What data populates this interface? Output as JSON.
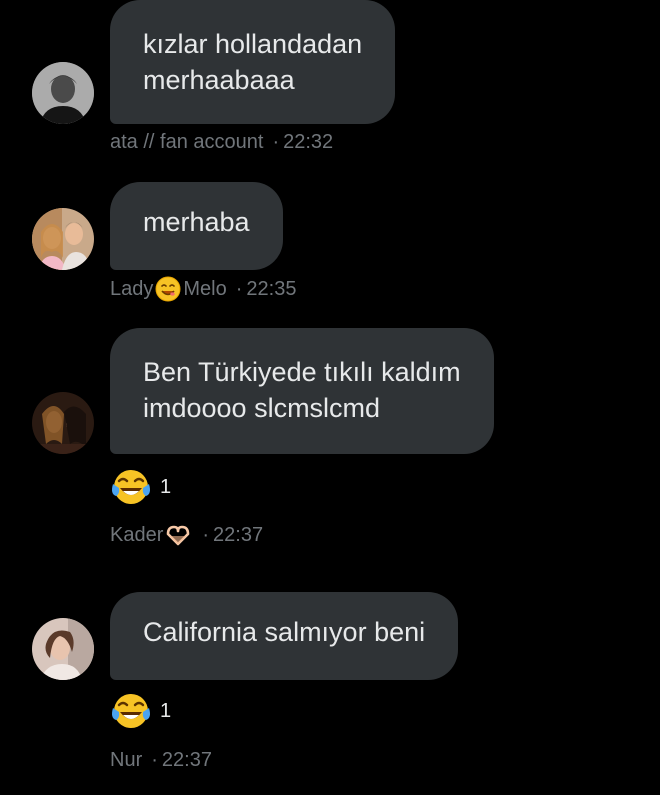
{
  "messages": [
    {
      "lines": [
        "kızlar hollandadan",
        "merhaabaaa"
      ],
      "sender": "ata // fan account",
      "time": "22:32",
      "reaction": null
    },
    {
      "lines": [
        "merhaba"
      ],
      "sender_prefix": "Lady",
      "sender_emoji": "smiling-face-emoji",
      "sender_suffix": "Melo",
      "time": "22:35",
      "reaction": null
    },
    {
      "lines": [
        "Ben Türkiyede tıkılı kaldım",
        "imdoooo slcmslcmd"
      ],
      "sender_prefix": "Kader",
      "sender_emoji": "heart-hands-emoji",
      "time": "22:37",
      "reaction": {
        "emoji": "tears-of-joy-emoji",
        "count": "1"
      }
    },
    {
      "lines": [
        "California salmıyor beni"
      ],
      "sender": "Nur",
      "time": "22:37",
      "reaction": {
        "emoji": "tears-of-joy-emoji",
        "count": "1"
      }
    }
  ],
  "time_separator": "·",
  "colors": {
    "background": "#000000",
    "bubble": "#2f3336",
    "text": "#e7e9ea",
    "meta": "#71767b"
  }
}
